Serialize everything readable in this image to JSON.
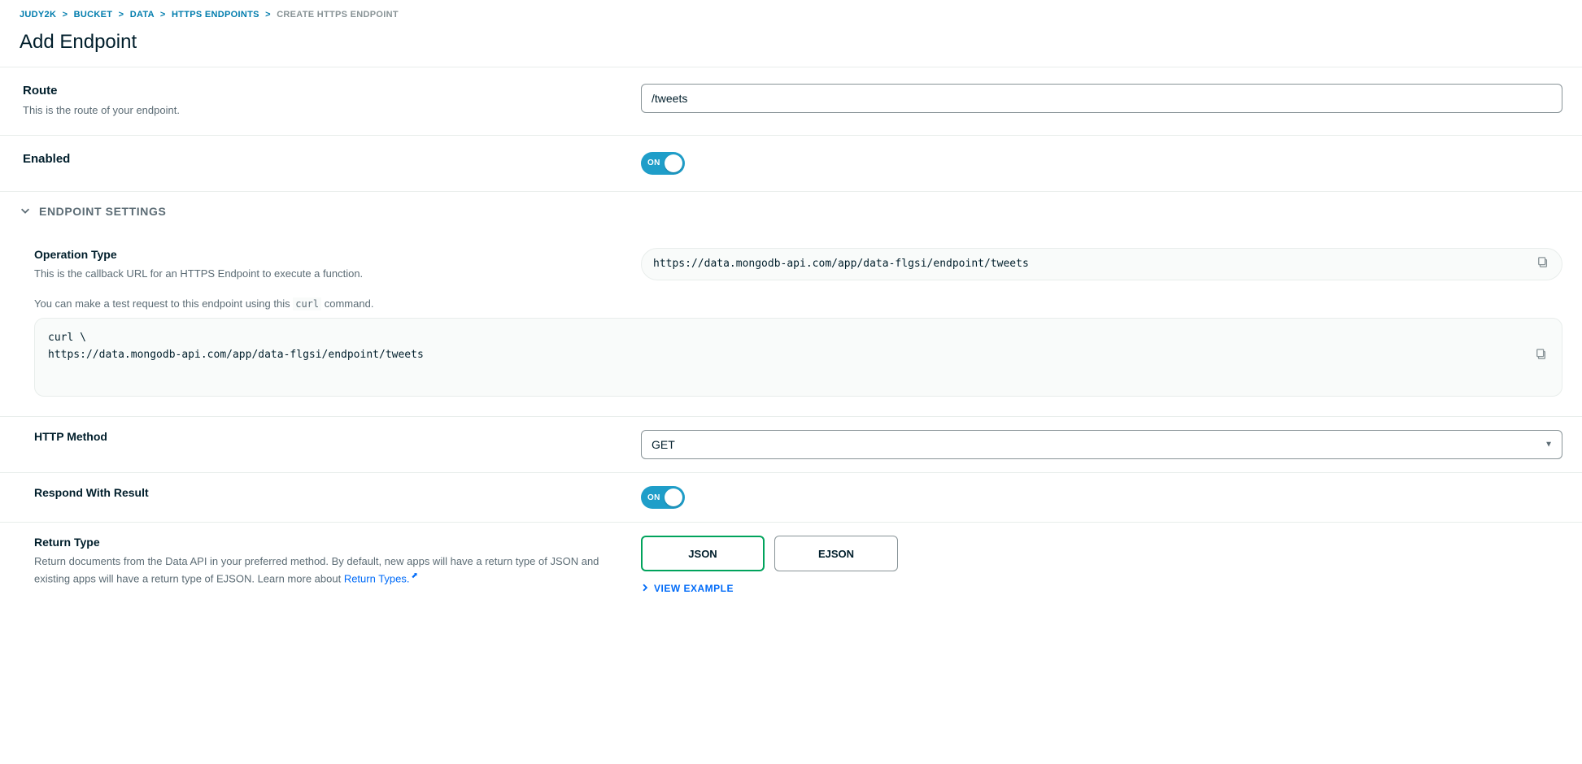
{
  "breadcrumb": {
    "items": [
      "JUDY2K",
      "BUCKET",
      "DATA",
      "HTTPS ENDPOINTS"
    ],
    "current": "CREATE HTTPS ENDPOINT"
  },
  "page_title": "Add Endpoint",
  "route": {
    "label": "Route",
    "desc": "This is the route of your endpoint.",
    "value": "/tweets"
  },
  "enabled": {
    "label": "Enabled",
    "toggle_text": "ON"
  },
  "section_title": "ENDPOINT SETTINGS",
  "operation": {
    "label": "Operation Type",
    "desc": "This is the callback URL for an HTTPS Endpoint to execute a function.",
    "url": "https://data.mongodb-api.com/app/data-flgsi/endpoint/tweets",
    "test_note_before": "You can make a test request to this endpoint using this ",
    "test_note_code": "curl",
    "test_note_after": " command.",
    "curl": "curl \\\nhttps://data.mongodb-api.com/app/data-flgsi/endpoint/tweets"
  },
  "http_method": {
    "label": "HTTP Method",
    "value": "GET"
  },
  "respond": {
    "label": "Respond With Result",
    "toggle_text": "ON"
  },
  "return_type": {
    "label": "Return Type",
    "desc_part1": "Return documents from the Data API in your preferred method. By default, new apps will have a return type of JSON and existing apps will have a return type of EJSON. Learn more about ",
    "link_text": "Return Types.",
    "options": [
      "JSON",
      "EJSON"
    ],
    "selected": "JSON",
    "view_example": "VIEW EXAMPLE"
  }
}
